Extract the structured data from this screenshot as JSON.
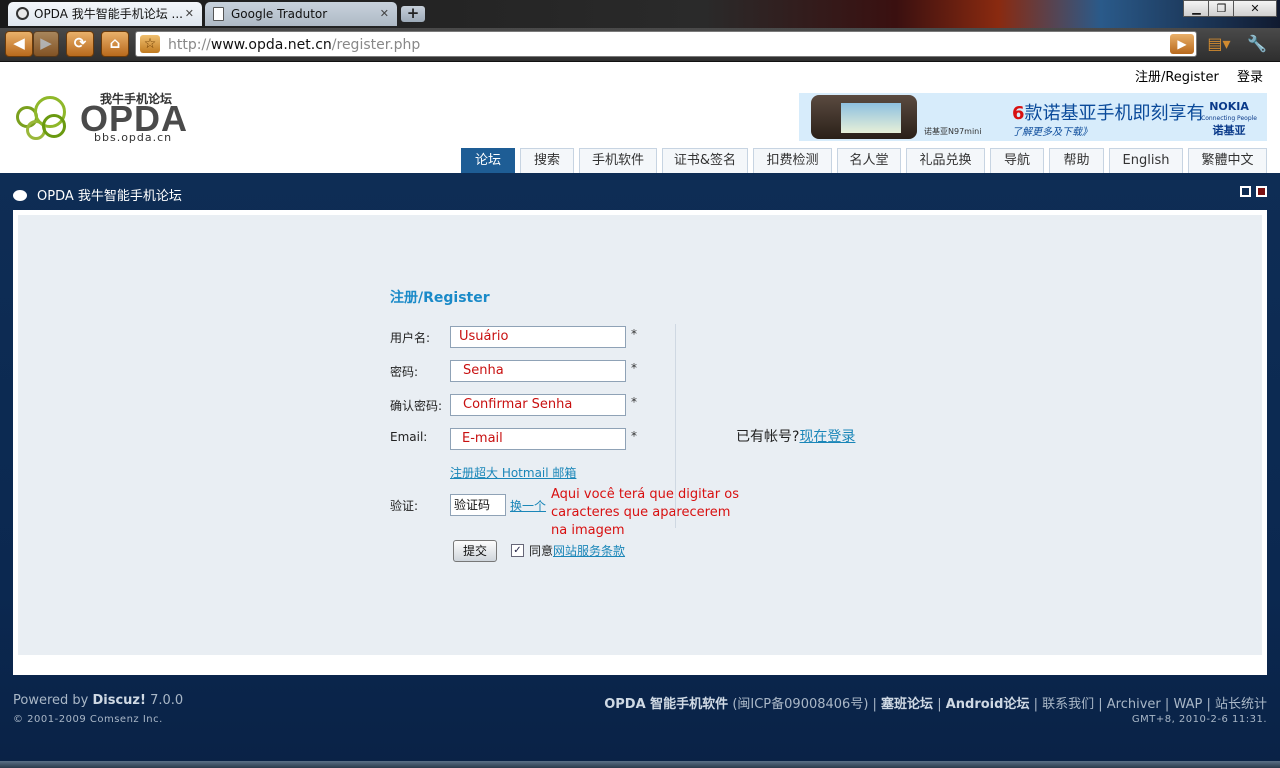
{
  "browser": {
    "tabs": [
      {
        "title": "OPDA 我牛智能手机论坛 ...",
        "active": true
      },
      {
        "title": "Google Tradutor",
        "active": false
      }
    ],
    "new_tab": "+",
    "url_prefix": "http://",
    "url_domain": "www.opda.net.cn",
    "url_path": "/register.php",
    "window_controls": {
      "minimize": "▁",
      "maximize": "❐",
      "close": "✕"
    },
    "accent": "#c87a28"
  },
  "header": {
    "top_links": [
      "注册/Register",
      "登录"
    ],
    "logo": {
      "tagline": "我牛手机论坛",
      "wordmark": "OPDA",
      "domain": "bbs.opda.cn"
    },
    "banner": {
      "six": "6",
      "slogan": "款诺基亚手机即刻享有",
      "more": "了解更多及下载》",
      "model": "诺基亚N97mini",
      "brand_en": "NOKIA",
      "brand_tag": "Connecting People",
      "brand_cn": "诺基亚"
    },
    "nav_tabs": [
      "论坛",
      "搜索",
      "手机软件",
      "证书&签名",
      "扣费检测",
      "名人堂",
      "礼品兑换",
      "导航",
      "帮助",
      "English",
      "繁體中文"
    ],
    "active_tab": "论坛"
  },
  "breadcrumb": "OPDA 我牛智能手机论坛",
  "form": {
    "title": "注册/Register",
    "fields": [
      {
        "label": "用户名:",
        "value": "Usuário",
        "required": "*"
      },
      {
        "label": "密码:",
        "value": "Senha",
        "required": "*"
      },
      {
        "label": "确认密码:",
        "value": "Confirmar Senha",
        "required": "*"
      },
      {
        "label": "Email:",
        "value": "E-mail",
        "required": "*"
      }
    ],
    "hotmail_link": "注册超大 Hotmail 邮箱",
    "captcha": {
      "label": "验证:",
      "value": "验证码",
      "change_link": "换一个"
    },
    "captcha_note": "Aqui você terá que digitar os caracteres que aparecerem na imagem",
    "submit_label": "提交",
    "agree_checked": true,
    "agree_text": "同意",
    "terms_link": "网站服务条款",
    "have_account": "已有帐号?",
    "login_link": "现在登录"
  },
  "footer": {
    "powered_prefix": "Powered by ",
    "powered_brand": "Discuz!",
    "powered_version": " 7.0.0",
    "copyright": "© 2001-2009 Comsenz Inc.",
    "site_name": "OPDA 智能手机软件",
    "icp": "(闽ICP备09008406号)",
    "links": [
      "塞班论坛",
      "Android论坛",
      "联系我们",
      "Archiver",
      "WAP",
      "站长统计"
    ],
    "time": "GMT+8, 2010-2-6 11:31."
  },
  "colors": {
    "nav_active": "#1e5d95",
    "band": "#0e2d55",
    "link": "#1a86b8",
    "note": "#d81010"
  }
}
